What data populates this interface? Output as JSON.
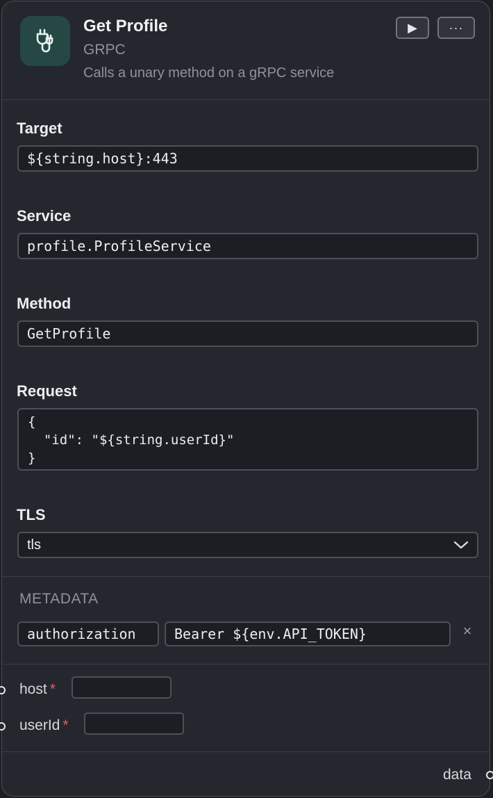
{
  "node": {
    "icon": "plug-icon",
    "title": "Get Profile",
    "type": "GRPC",
    "description": "Calls a unary method on a gRPC service",
    "run_label": "▶",
    "more_label": "···"
  },
  "fields": {
    "target": {
      "label": "Target",
      "value": "${string.host}:443"
    },
    "service": {
      "label": "Service",
      "value": "profile.ProfileService"
    },
    "method": {
      "label": "Method",
      "value": "GetProfile"
    },
    "request": {
      "label": "Request",
      "value": "{\n  \"id\": \"${string.userId}\"\n}"
    },
    "tls": {
      "label": "TLS",
      "value": "tls",
      "icon": "chevron-down-icon"
    }
  },
  "metadata": {
    "title": "METADATA",
    "entries": [
      {
        "key": "authorization",
        "value": "Bearer ${env.API_TOKEN}",
        "remove_label": "×"
      }
    ]
  },
  "params": [
    {
      "name": "host",
      "required_mark": "*",
      "value": ""
    },
    {
      "name": "userId",
      "required_mark": "*",
      "value": ""
    }
  ],
  "output": {
    "label": "data"
  },
  "colors": {
    "background": "#1d1f24",
    "card": "#25272e",
    "icon_bg": "#264845",
    "required": "#e0605e",
    "muted_text": "#8e929b"
  }
}
